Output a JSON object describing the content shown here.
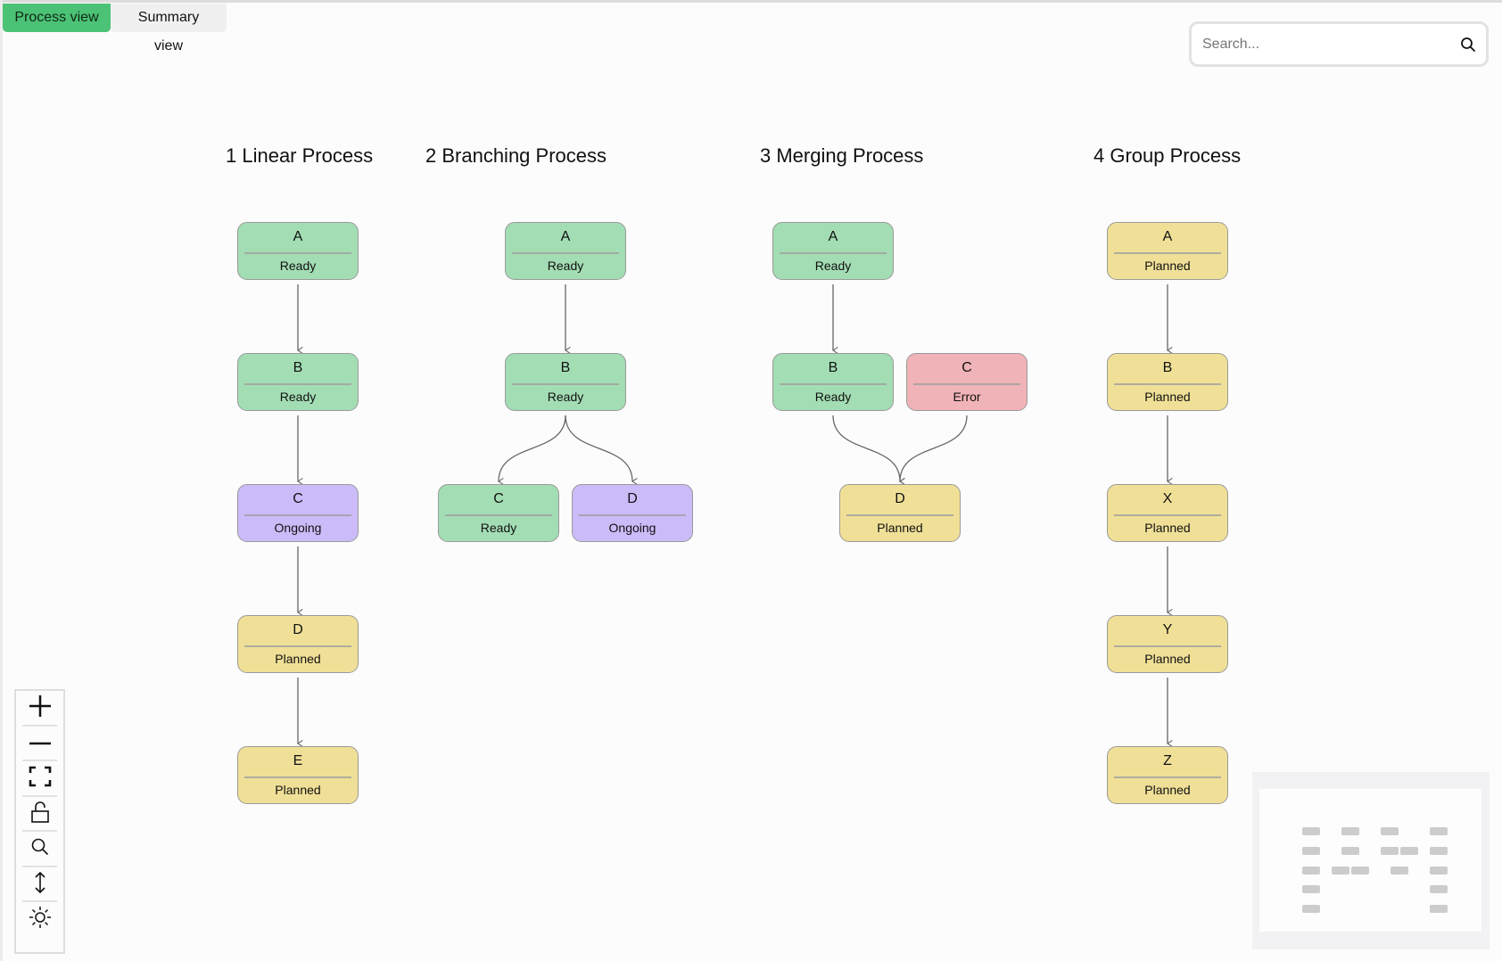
{
  "tabs": [
    {
      "label": "Process view",
      "active": true
    },
    {
      "label": "Summary view",
      "active": false
    }
  ],
  "search": {
    "placeholder": "Search...",
    "value": "",
    "icon": "search-icon"
  },
  "colors": {
    "Ready": "#a3ddb4",
    "Ongoing": "#cbbbf8",
    "Planned": "#f0e097",
    "Error": "#f0b3b7",
    "active_tab": "#4cc276"
  },
  "processes": [
    {
      "title": "1 Linear Process",
      "nodes": [
        {
          "id": "A",
          "status": "Ready"
        },
        {
          "id": "B",
          "status": "Ready"
        },
        {
          "id": "C",
          "status": "Ongoing"
        },
        {
          "id": "D",
          "status": "Planned"
        },
        {
          "id": "E",
          "status": "Planned"
        }
      ],
      "edges": [
        [
          "A",
          "B"
        ],
        [
          "B",
          "C"
        ],
        [
          "C",
          "D"
        ],
        [
          "D",
          "E"
        ]
      ]
    },
    {
      "title": "2 Branching Process",
      "nodes": [
        {
          "id": "A",
          "status": "Ready"
        },
        {
          "id": "B",
          "status": "Ready"
        },
        {
          "id": "C",
          "status": "Ready"
        },
        {
          "id": "D",
          "status": "Ongoing"
        }
      ],
      "edges": [
        [
          "A",
          "B"
        ],
        [
          "B",
          "C"
        ],
        [
          "B",
          "D"
        ]
      ]
    },
    {
      "title": "3 Merging Process",
      "nodes": [
        {
          "id": "A",
          "status": "Ready"
        },
        {
          "id": "B",
          "status": "Ready"
        },
        {
          "id": "C",
          "status": "Error"
        },
        {
          "id": "D",
          "status": "Planned"
        }
      ],
      "edges": [
        [
          "A",
          "B"
        ],
        [
          "B",
          "D"
        ],
        [
          "C",
          "D"
        ]
      ]
    },
    {
      "title": "4 Group Process",
      "nodes": [
        {
          "id": "A",
          "status": "Planned"
        },
        {
          "id": "B",
          "status": "Planned"
        },
        {
          "id": "X",
          "status": "Planned"
        },
        {
          "id": "Y",
          "status": "Planned"
        },
        {
          "id": "Z",
          "status": "Planned"
        }
      ],
      "edges": [
        [
          "A",
          "B"
        ],
        [
          "B",
          "X"
        ],
        [
          "X",
          "Y"
        ],
        [
          "Y",
          "Z"
        ]
      ]
    }
  ],
  "controls": [
    {
      "name": "zoom-in",
      "icon": "plus-icon"
    },
    {
      "name": "zoom-out",
      "icon": "minus-icon"
    },
    {
      "name": "fit-view",
      "icon": "fit-view-icon"
    },
    {
      "name": "toggle-lock",
      "icon": "unlock-icon"
    },
    {
      "name": "search",
      "icon": "search-icon"
    },
    {
      "name": "vertical-layout",
      "icon": "vertical-arrows-icon"
    },
    {
      "name": "theme-toggle",
      "icon": "sun-icon"
    }
  ]
}
